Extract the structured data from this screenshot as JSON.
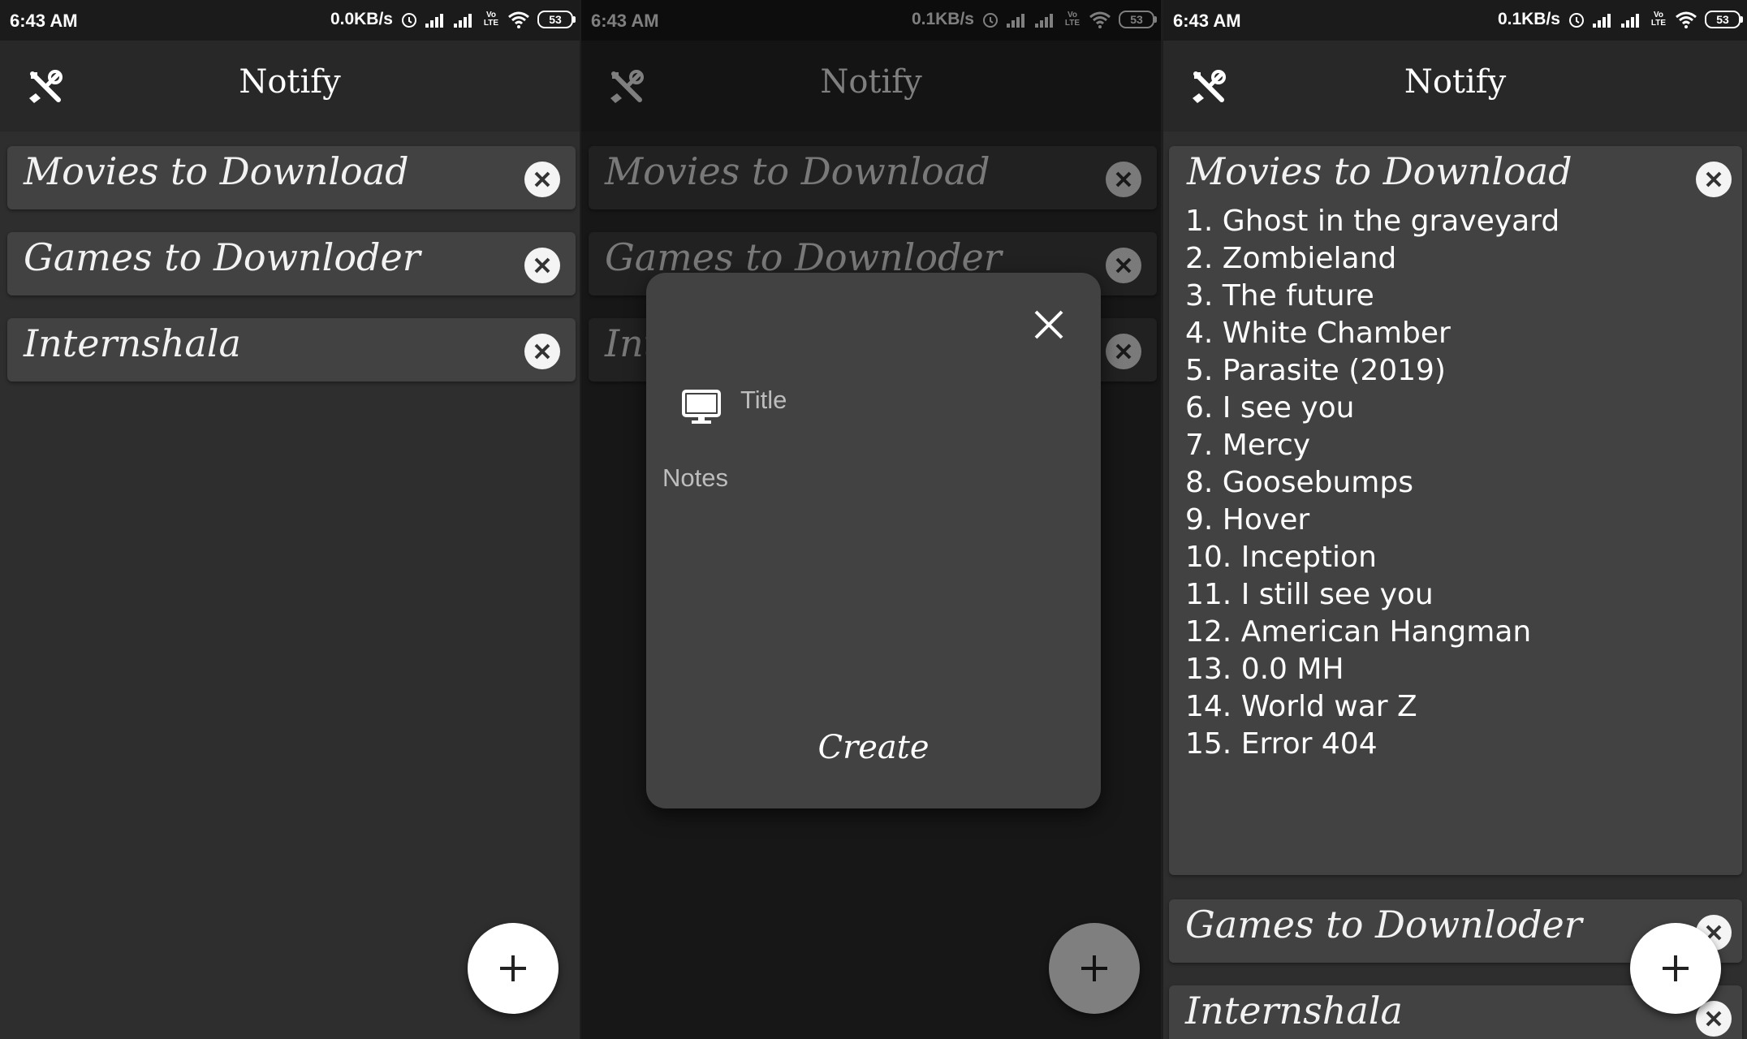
{
  "screens": [
    {
      "status": {
        "time": "6:43 AM",
        "speed": "0.0KB/s",
        "volte": "Vo LTE",
        "battery": "53"
      },
      "appbar": {
        "title": "Notify",
        "settings_icon": "tools-icon"
      },
      "cards": [
        {
          "title": "Movies to Download"
        },
        {
          "title": "Games to Downloder"
        },
        {
          "title": "Internshala"
        }
      ],
      "fab_icon": "plus-icon"
    },
    {
      "status": {
        "time": "6:43 AM",
        "speed": "0.1KB/s",
        "volte": "Vo LTE",
        "battery": "53"
      },
      "appbar": {
        "title": "Notify",
        "settings_icon": "tools-icon"
      },
      "cards": [
        {
          "title": "Movies to Download"
        },
        {
          "title": "Games to Downloder"
        },
        {
          "title": "Internshala"
        }
      ],
      "dialog": {
        "title_placeholder": "Title",
        "notes_placeholder": "Notes",
        "create_label": "Create",
        "title_icon": "monitor-icon",
        "close_icon": "close-icon"
      },
      "fab_icon": "plus-icon"
    },
    {
      "status": {
        "time": "6:43 AM",
        "speed": "0.1KB/s",
        "volte": "Vo LTE",
        "battery": "53"
      },
      "appbar": {
        "title": "Notify",
        "settings_icon": "tools-icon"
      },
      "expanded_card": {
        "title": "Movies to Download",
        "notes": [
          "1. Ghost in the graveyard",
          "2. Zombieland",
          "3. The future",
          "4. White Chamber",
          "5. Parasite (2019)",
          "6. I see you",
          "7. Mercy",
          "8. Goosebumps",
          "9. Hover",
          "10. Inception",
          "11. I still see you",
          "12. American Hangman",
          "13. 0.0 MH",
          "14. World war Z",
          "15. Error 404"
        ]
      },
      "cards": [
        {
          "title": "Games to Downloder"
        },
        {
          "title": "Internshala"
        }
      ],
      "fab_icon": "plus-icon"
    }
  ],
  "colors": {
    "background": "#2e2e2e",
    "card": "#424242",
    "appbar": "#282828",
    "fab": "#ffffff"
  }
}
